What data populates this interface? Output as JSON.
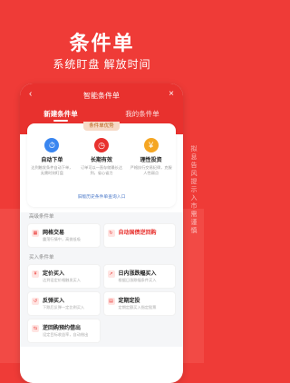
{
  "hero": {
    "title": "条件单",
    "subtitle": "系统盯盘 解放时间"
  },
  "side_note": "拟息告风提示入市需谨慎",
  "phone": {
    "header": {
      "title": "智能条件单",
      "back_icon": "chevron-left",
      "close_icon": "close"
    },
    "tabs": [
      {
        "label": "新建条件单",
        "active": true
      },
      {
        "label": "我的条件单",
        "active": false
      }
    ],
    "advantage": {
      "tag": "条件单优势",
      "items": [
        {
          "icon": "clock-icon",
          "icon_char": "⏱",
          "color": "#3a86f0",
          "name": "自动下单",
          "desc": "达到触发条件自动下单，无需时刻盯盘"
        },
        {
          "icon": "time-icon",
          "icon_char": "◷",
          "color": "#e8312e",
          "name": "长期有效",
          "desc": "订单可以一直存储最长达到，省心省力"
        },
        {
          "icon": "coin-icon",
          "icon_char": "¥",
          "color": "#f5a623",
          "name": "理性投资",
          "desc": "严格执行交易纪律，克服人性弱点"
        }
      ],
      "link": "旧版历史条件单查询入口"
    },
    "advanced": {
      "title": "高级条件单",
      "items": [
        {
          "icon": "grid-icon",
          "name": "网格交易",
          "desc": "震荡行情中，高抛低吸"
        },
        {
          "icon": "refresh-icon",
          "name": "自动国债逆回购",
          "desc": ""
        }
      ]
    },
    "buy": {
      "title": "买入条件单",
      "items": [
        {
          "icon": "price-icon",
          "name": "定价买入",
          "desc": "达到设定价格触发买入"
        },
        {
          "icon": "rise-icon",
          "name": "日内涨跌幅买入",
          "desc": "根据日涨跌幅条件买入"
        },
        {
          "icon": "rebound-icon",
          "name": "反弹买入",
          "desc": "下跌后反弹一定比例买入"
        },
        {
          "icon": "calendar-icon",
          "name": "定期定投",
          "desc": "定期定额买入指定股票"
        }
      ]
    },
    "more": {
      "items": [
        {
          "icon": "reverse-icon",
          "name": "逆回购预约借出",
          "desc": "设定目标收益率，自动借出"
        }
      ]
    }
  },
  "colors": {
    "brand": "#ef3b37",
    "header": "#e8312e",
    "link": "#4a78c8"
  }
}
